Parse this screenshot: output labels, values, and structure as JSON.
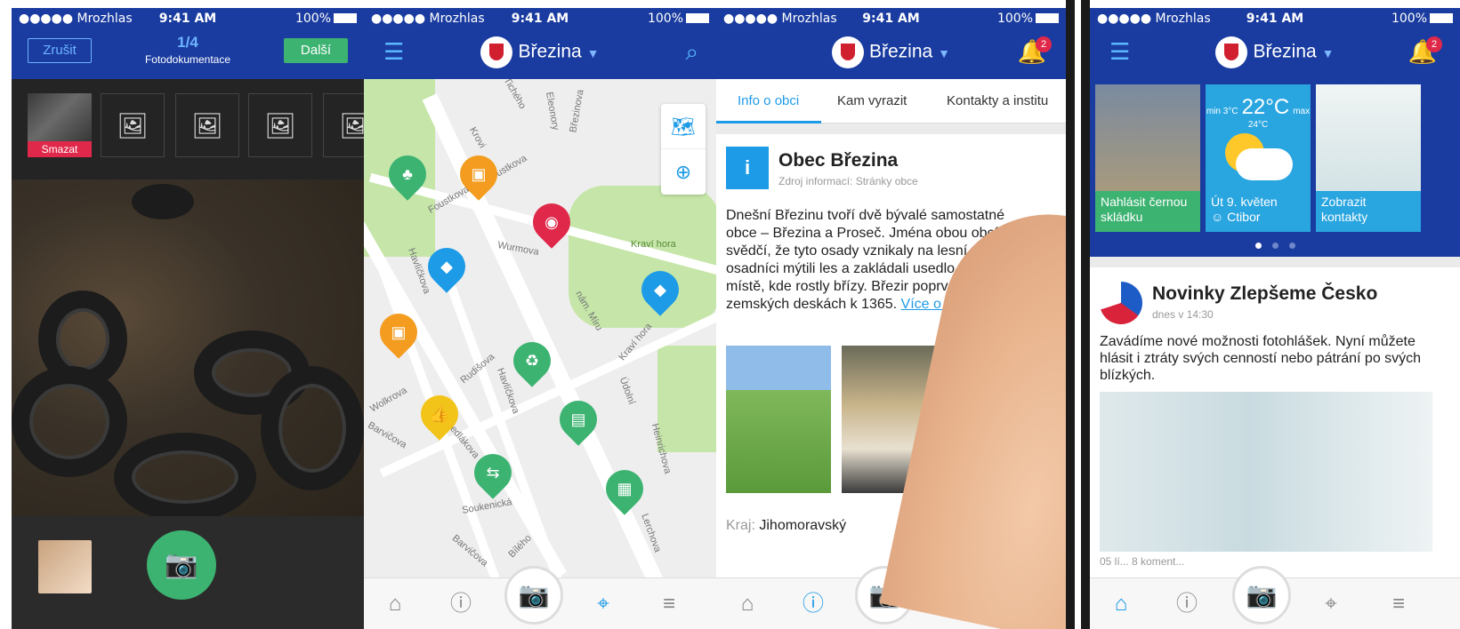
{
  "status": {
    "carrier": "●●●●● Mrozhlas",
    "time": "9:41 AM",
    "battery": "100%"
  },
  "screen1": {
    "cancel_label": "Zrušit",
    "step": "1/4",
    "step_label": "Fotodokumentace",
    "next_label": "Další",
    "delete_label": "Smazat"
  },
  "screen2": {
    "town": "Březina",
    "streets": [
      "Tichého",
      "Eleonory",
      "Březinova",
      "Krovi",
      "Foustkova",
      "Foustkova",
      "Wurmova",
      "Havlíčkova",
      "Kraví hora",
      "Rudišova",
      "Havlíčkova",
      "Wolkrova",
      "Barvičova",
      "nám. Míru",
      "Kraví hora",
      "Údolní",
      "Sedlákova",
      "Heinrichova",
      "Barvičova",
      "Bílého",
      "Lerchova",
      "Soukenická"
    ]
  },
  "screen3": {
    "town": "Březina",
    "tabs": [
      "Info o obci",
      "Kam vyrazit",
      "Kontakty a institu"
    ],
    "title": "Obec Březina",
    "source": "Zdroj informací: Stránky obce",
    "body": "Dnešní Březinu tvoří dvě bývalé samostatné obce – Březina a Proseč. Jména obou obcí svědčí, že tyto osady vznikaly na lesní půd první osadníci mýtili les a zakládali usedlo Březina je v místě, kde rostly břízy. Březir poprvé připomíná v zemských deskách k 1365.",
    "more": "Více o obci",
    "region_key": "Kraj:",
    "region_val": "Jihomoravský",
    "badge": "2"
  },
  "screen4": {
    "town": "Březina",
    "badge": "2",
    "card1": "Nahlásit černou skládku",
    "weather": {
      "min_label": "min",
      "min": "3°C",
      "temp": "22°C",
      "max_label": "max",
      "max": "24°C",
      "caption": "Út 9. květen",
      "nameday": "☺ Ctibor"
    },
    "card3": "Zobrazit kontakty",
    "news_title": "Novinky Zlepšeme Česko",
    "news_time": "dnes v 14:30",
    "news_body": "Zavádíme nové možnosti fotohlášek. Nyní můžete hlásit i ztráty svých cenností nebo pátrání po svých blízkých.",
    "news_meta": "05 lí... 8 koment..."
  }
}
